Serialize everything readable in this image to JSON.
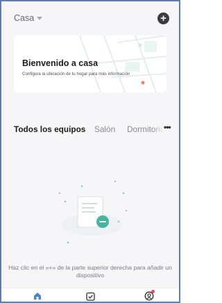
{
  "header": {
    "home_name": "Casa",
    "add_icon": "plus-circle-icon"
  },
  "welcome": {
    "title": "Bienvenido a casa",
    "subtitle": "Configura la ubicación de tu hogar para más información"
  },
  "tabs": {
    "items": [
      {
        "label": "Todos los equipos",
        "active": true
      },
      {
        "label": "Salón",
        "active": false
      },
      {
        "label": "Dormitorio",
        "active": false
      }
    ],
    "more_label": "•••"
  },
  "empty_state": {
    "message": "Haz clic en el «+» de la parte superior derecha para añadir un dispositivo"
  },
  "bottom_nav": {
    "items": [
      {
        "icon": "home-icon",
        "active": true
      },
      {
        "icon": "scenes-checkbox-icon",
        "active": false
      },
      {
        "icon": "profile-icon",
        "active": false,
        "notification": true
      }
    ]
  },
  "colors": {
    "accent_teal": "#45b59d",
    "nav_active": "#4a86c5",
    "notification": "#f0485a"
  }
}
